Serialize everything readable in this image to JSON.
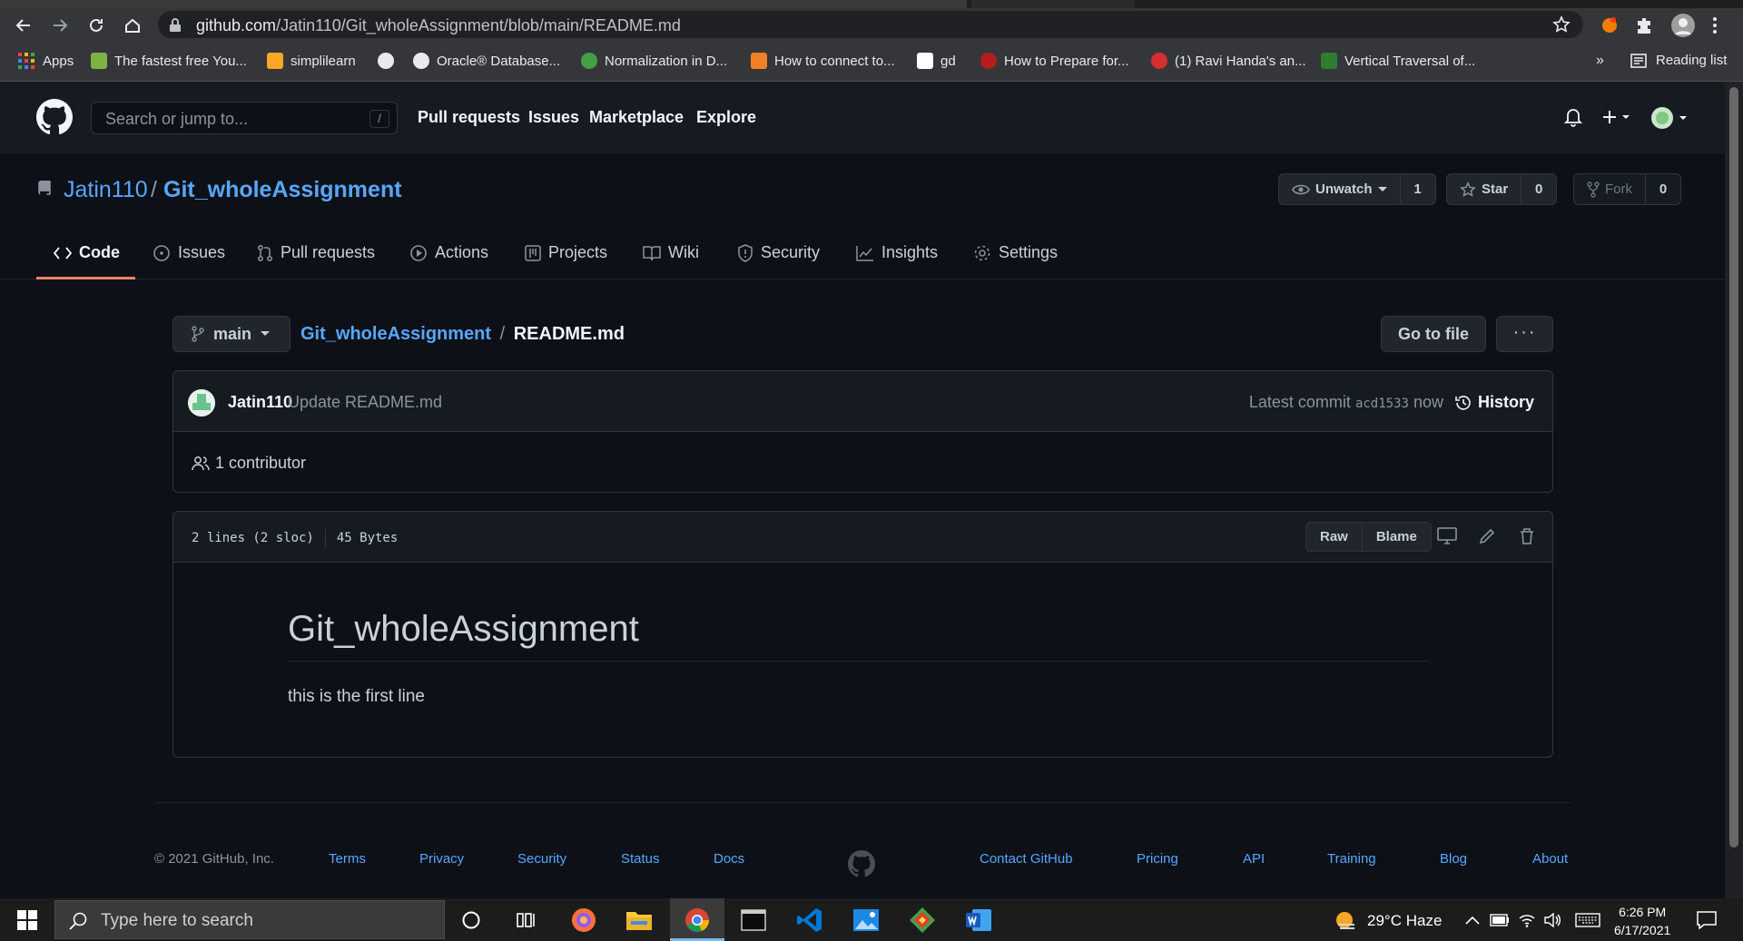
{
  "browser": {
    "url_host": "github.com",
    "url_path": "/Jatin110/Git_wholeAssignment/blob/main/README.md",
    "bookmarks": [
      {
        "label": "Apps",
        "color": "#ea4335"
      },
      {
        "label": "The fastest free You...",
        "color": "#7cb342"
      },
      {
        "label": "simplilearn",
        "color": "#f9a825"
      },
      {
        "label": "",
        "color": "#e8eaed"
      },
      {
        "label": "Oracle® Database...",
        "color": "#e8eaed"
      },
      {
        "label": "Normalization in D...",
        "color": "#43a047"
      },
      {
        "label": "How to connect to...",
        "color": "#f48024"
      },
      {
        "label": "gd",
        "color": "#ffffff"
      },
      {
        "label": "How to Prepare for...",
        "color": "#b71c1c"
      },
      {
        "label": "(1) Ravi Handa's an...",
        "color": "#d32f2f"
      },
      {
        "label": "Vertical Traversal of...",
        "color": "#2e7d32"
      }
    ],
    "bookmarks_overflow": "»",
    "reading_list": "Reading list"
  },
  "header": {
    "search_placeholder": "Search or jump to...",
    "search_shortcut": "/",
    "nav": [
      "Pull requests",
      "Issues",
      "Marketplace",
      "Explore"
    ]
  },
  "repo": {
    "owner": "Jatin110",
    "separator": "/",
    "name": "Git_wholeAssignment",
    "watch_label": "Unwatch",
    "watch_count": "1",
    "star_label": "Star",
    "star_count": "0",
    "fork_label": "Fork",
    "fork_count": "0",
    "tabs": [
      "Code",
      "Issues",
      "Pull requests",
      "Actions",
      "Projects",
      "Wiki",
      "Security",
      "Insights",
      "Settings"
    ]
  },
  "file_header": {
    "branch": "main",
    "crumb_repo": "Git_wholeAssignment",
    "crumb_sep": "/",
    "crumb_file": "README.md",
    "goto_file": "Go to file",
    "more": "···"
  },
  "commit": {
    "author": "Jatin110",
    "message": "Update README.md",
    "latest_label": "Latest commit",
    "sha": "acd1533",
    "when": "now",
    "history": "History",
    "contributors": "1 contributor"
  },
  "file": {
    "lines": "2 lines (2 sloc)",
    "size": "45 Bytes",
    "raw": "Raw",
    "blame": "Blame",
    "md_heading": "Git_wholeAssignment",
    "md_paragraph": "this is the first line"
  },
  "footer": {
    "copyright": "© 2021 GitHub, Inc.",
    "links": [
      "Terms",
      "Privacy",
      "Security",
      "Status",
      "Docs",
      "Contact GitHub",
      "Pricing",
      "API",
      "Training",
      "Blog",
      "About"
    ]
  },
  "taskbar": {
    "search_placeholder": "Type here to search",
    "weather": "29°C  Haze",
    "time": "6:26 PM",
    "date": "6/17/2021"
  },
  "colors": {
    "page_bg": "#0d1117",
    "header_bg": "#161b22",
    "link": "#58a6ff",
    "tab_underline": "#f78166"
  }
}
